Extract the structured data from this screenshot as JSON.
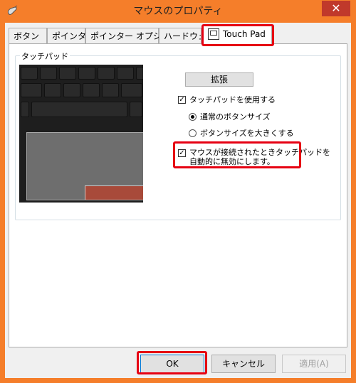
{
  "window": {
    "title": "マウスのプロパティ",
    "close_label": "✕"
  },
  "tabs": [
    {
      "label": "ボタン"
    },
    {
      "label": "ポインター"
    },
    {
      "label": "ポインター オプション"
    },
    {
      "label": "ハードウェア"
    },
    {
      "label": "Touch Pad",
      "active": true
    }
  ],
  "touchpad": {
    "group_label": "タッチパッド",
    "expand_button": "拡張",
    "use_touchpad_label": "タッチパッドを使用する",
    "use_touchpad_checked": true,
    "radio_normal_label": "通常のボタンサイズ",
    "radio_normal_selected": true,
    "radio_large_label": "ボタンサイズを大きくする",
    "radio_large_selected": false,
    "auto_disable_line1": "マウスが接続されたときタッチパッドを",
    "auto_disable_line2": "自動的に無効にします。",
    "auto_disable_checked": true
  },
  "footer": {
    "ok": "OK",
    "cancel": "キャンセル",
    "apply": "適用(A)"
  },
  "colors": {
    "frame": "#f57e2a",
    "highlight": "#e60012",
    "close": "#c0392b"
  }
}
